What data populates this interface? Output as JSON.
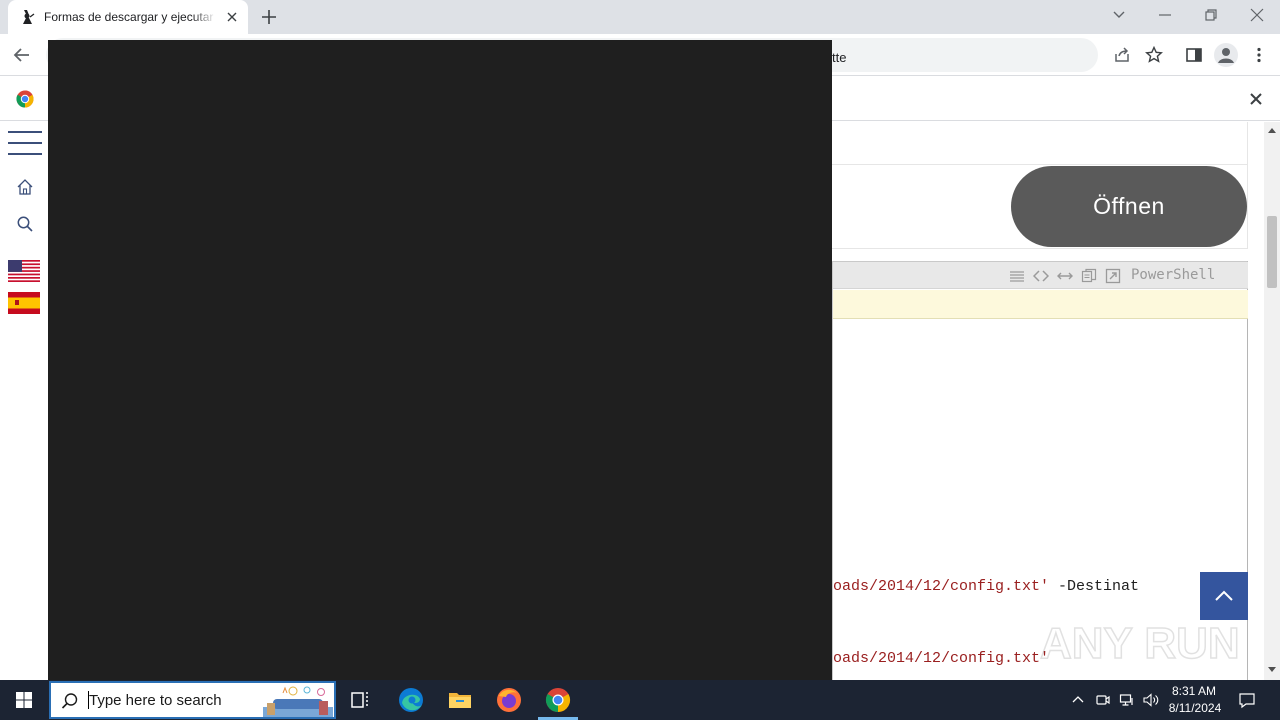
{
  "browser": {
    "tab_title": "Formas de descargar y ejecutar f",
    "omnibox_visible_text": "tte"
  },
  "page": {
    "open_button_label": "Öffnen",
    "code_box": {
      "language_label": "PowerShell",
      "line_1_string": "oads/2014/12/config.txt'",
      "line_1_rest": " -Destinat",
      "line_2_string": "oads/2014/12/config.txt'"
    }
  },
  "taskbar": {
    "search_placeholder": "Type here to search",
    "clock_time": "8:31 AM",
    "clock_date": "8/11/2024"
  },
  "watermark": "ANY RUN",
  "colors": {
    "overlay": "#1f1f1f",
    "open_button": "#5a5a5a",
    "back_to_top": "#34559e",
    "code_string": "#9a2020",
    "code_highlight": "#fdf9dc",
    "taskbar": "#1c2433"
  },
  "icons": {
    "tab_favicon": "wizard-icon",
    "infobar": "chrome-logo-icon",
    "taskbar_apps": [
      "task-view-icon",
      "edge-icon",
      "file-explorer-icon",
      "firefox-icon",
      "chrome-icon"
    ]
  }
}
